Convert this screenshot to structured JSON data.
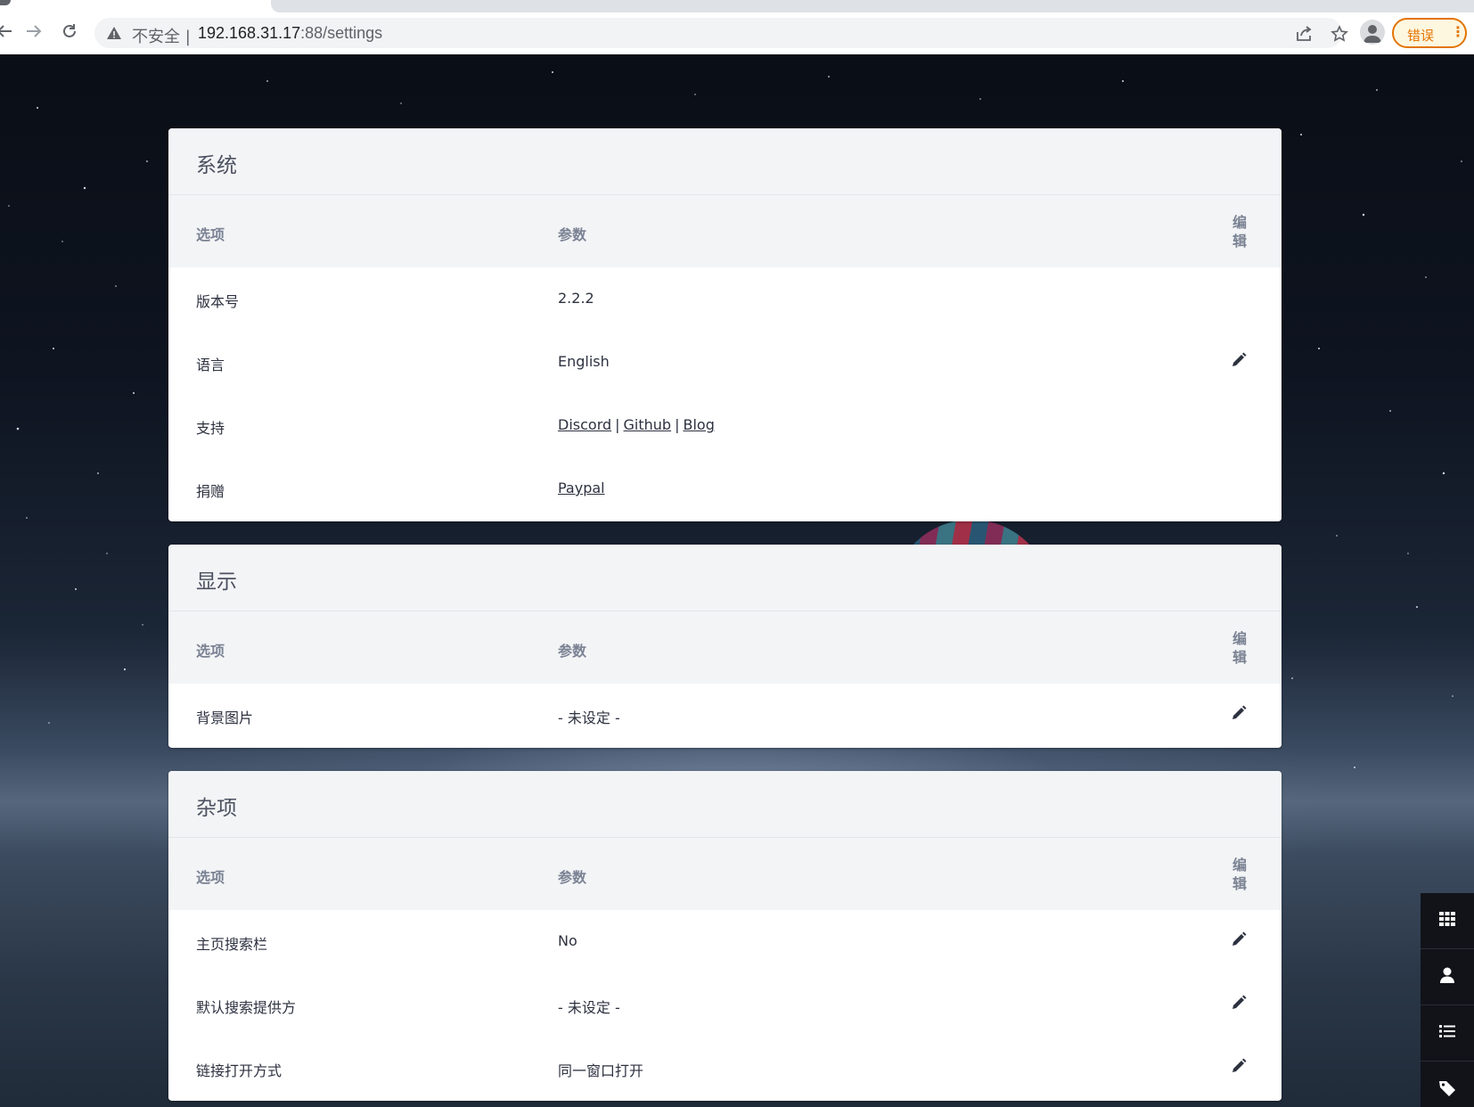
{
  "browser": {
    "insecure_label": "不安全",
    "url_host": "192.168.31.17",
    "url_path": ":88/settings",
    "error_chip_label": "错误",
    "icons": [
      "back-arrow-icon",
      "forward-arrow-icon",
      "reload-icon",
      "warning-icon",
      "share-icon",
      "star-icon",
      "profile-icon",
      "kebab-menu-icon"
    ]
  },
  "sections": {
    "system": {
      "title": "系统",
      "headers": {
        "option": "选项",
        "value": "参数",
        "edit": "编辑"
      },
      "rows": [
        {
          "option": "版本号",
          "value": "2.2.2",
          "editable": false
        },
        {
          "option": "语言",
          "value": "English",
          "editable": true
        },
        {
          "option": "支持",
          "links": [
            "Discord",
            "Github",
            "Blog"
          ],
          "editable": false
        },
        {
          "option": "捐赠",
          "links": [
            "Paypal"
          ],
          "editable": false
        }
      ]
    },
    "display": {
      "title": "显示",
      "headers": {
        "option": "选项",
        "value": "参数",
        "edit": "编辑"
      },
      "rows": [
        {
          "option": "背景图片",
          "value": "- 未设定 -",
          "editable": true
        }
      ]
    },
    "misc": {
      "title": "杂项",
      "headers": {
        "option": "选项",
        "value": "参数",
        "edit": "编辑"
      },
      "rows": [
        {
          "option": "主页搜索栏",
          "value": "No",
          "editable": true
        },
        {
          "option": "默认搜索提供方",
          "value": "- 未设定 -",
          "editable": true
        },
        {
          "option": "链接打开方式",
          "value": "同一窗口打开",
          "editable": true
        }
      ]
    }
  },
  "sidebar": {
    "items": [
      "apps-grid-icon",
      "user-icon",
      "list-icon",
      "tag-icon"
    ]
  },
  "colors": {
    "card_header_bg": "#f3f4f6",
    "text": "#2d3240",
    "muted": "#7a8293",
    "error_accent": "#e37400"
  }
}
